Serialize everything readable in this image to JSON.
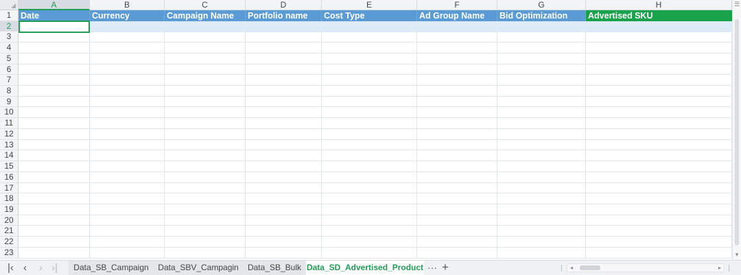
{
  "columns": [
    {
      "letter": "A",
      "header": "Date"
    },
    {
      "letter": "B",
      "header": "Currency"
    },
    {
      "letter": "C",
      "header": "Campaign Name"
    },
    {
      "letter": "D",
      "header": "Portfolio name"
    },
    {
      "letter": "E",
      "header": "Cost Type"
    },
    {
      "letter": "F",
      "header": "Ad Group Name"
    },
    {
      "letter": "G",
      "header": "Bid Optimization"
    },
    {
      "letter": "H",
      "header": "Advertised SKU"
    }
  ],
  "rows": [
    "1",
    "2",
    "3",
    "4",
    "5",
    "6",
    "7",
    "8",
    "9",
    "10",
    "11",
    "12",
    "13",
    "14",
    "15",
    "16",
    "17",
    "18",
    "19",
    "20",
    "21",
    "22",
    "23"
  ],
  "selected_cell": "A2",
  "colors": {
    "header_fill": "#5b9bd5",
    "highlight_header_fill": "#18a34a",
    "selection": "#1f9d55",
    "row_band": "#ddebf7"
  },
  "sheet_tabs": [
    {
      "label": "Data_SB_Campaign",
      "active": false
    },
    {
      "label": "Data_SBV_Campagin",
      "active": false
    },
    {
      "label": "Data_SB_Bulk",
      "active": false
    },
    {
      "label": "Data_SD_Advertised_Product",
      "active": true
    }
  ],
  "tab_tools": {
    "more": "···",
    "add": "+"
  },
  "nav_icons": [
    "first-sheet-icon",
    "prev-sheet-icon",
    "next-sheet-icon",
    "last-sheet-icon"
  ]
}
